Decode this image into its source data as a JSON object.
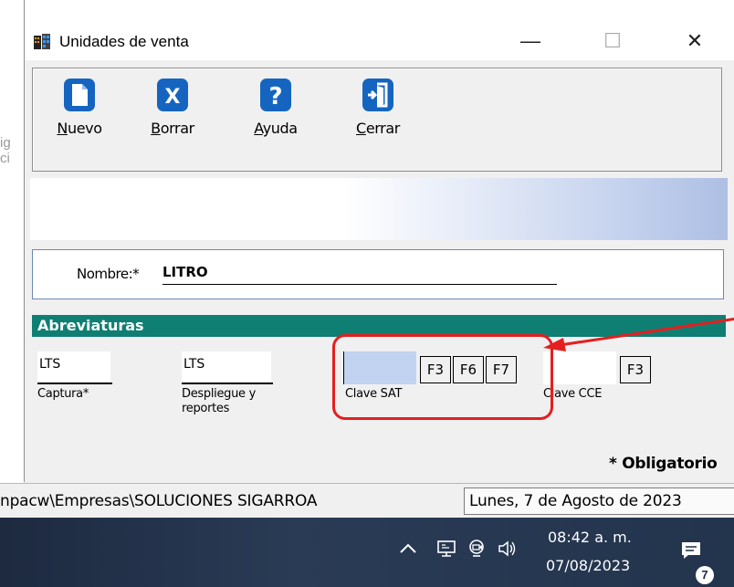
{
  "window": {
    "title": "Unidades de venta",
    "controls": {
      "minimize": "—",
      "maximize": "☐",
      "close": "✕"
    }
  },
  "toolbar": {
    "buttons": [
      {
        "label": "Nuevo",
        "icon": "new-document-icon"
      },
      {
        "label": "Borrar",
        "icon": "delete-x-icon"
      },
      {
        "label": "Ayuda",
        "icon": "help-question-icon"
      },
      {
        "label": "Cerrar",
        "icon": "exit-door-icon"
      }
    ]
  },
  "form": {
    "nombre_label": "Nombre:*",
    "nombre_value": "LITRO",
    "section_title": "Abreviaturas",
    "captura": {
      "value": "LTS",
      "caption": "Captura*"
    },
    "despliegue": {
      "value": "LTS",
      "caption": "Despliegue y reportes"
    },
    "clave_sat": {
      "value": "",
      "caption": "Clave SAT",
      "keys": [
        "F3",
        "F6",
        "F7"
      ]
    },
    "clave_cce": {
      "value": "",
      "caption": "Clave CCE",
      "keys": [
        "F3"
      ]
    },
    "required_note": "* Obligatorio"
  },
  "statusbar": {
    "path": "npacw\\Empresas\\SOLUCIONES SIGARROA",
    "date": "Lunes, 7 de Agosto de 2023"
  },
  "taskbar": {
    "time": "08:42 a. m.",
    "date": "07/08/2023",
    "notification_count": "7"
  },
  "annotation": {
    "color": "#e51f1f"
  },
  "colors": {
    "section_header": "#0f7f73",
    "sat_input": "#c2d3f1",
    "icon_blue": "#1565c0"
  }
}
